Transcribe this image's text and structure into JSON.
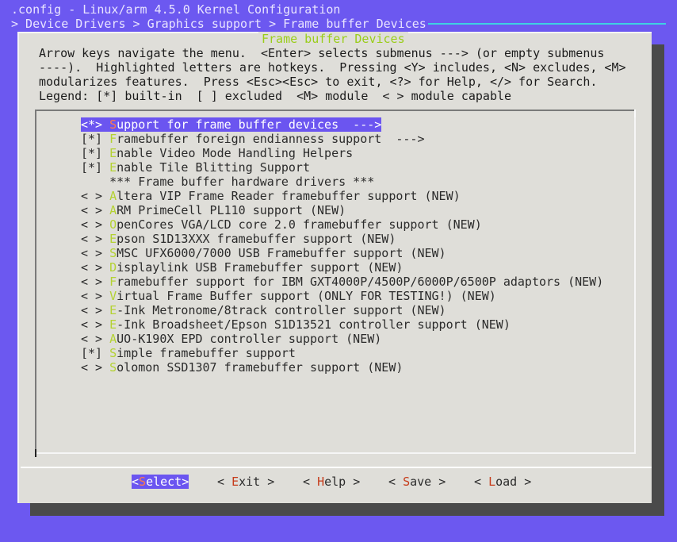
{
  "window": {
    "title": ".config - Linux/arm 4.5.0 Kernel Configuration",
    "breadcrumb": "> Device Drivers > Graphics support > Frame buffer Devices"
  },
  "dialog": {
    "title": "Frame buffer Devices",
    "help_lines": [
      "Arrow keys navigate the menu.  <Enter> selects submenus ---> (or empty submenus",
      "----).  Highlighted letters are hotkeys.  Pressing <Y> includes, <N> excludes, <M>",
      "modularizes features.  Press <Esc><Esc> to exit, <?> for Help, </> for Search.",
      "Legend: [*] built-in  [ ] excluded  <M> module  < > module capable"
    ]
  },
  "menu": {
    "items": [
      {
        "state": "<*>",
        "hot": "S",
        "rest": "upport for frame buffer devices  --->",
        "selected": true
      },
      {
        "state": "[*]",
        "hot": "F",
        "rest": "ramebuffer foreign endianness support  --->"
      },
      {
        "state": "[*]",
        "hot": "E",
        "rest": "nable Video Mode Handling Helpers"
      },
      {
        "state": "[*]",
        "hot": "E",
        "rest": "nable Tile Blitting Support"
      },
      {
        "state": "   ",
        "hot": "",
        "rest": "*** Frame buffer hardware drivers ***"
      },
      {
        "state": "< >",
        "hot": "A",
        "rest": "ltera VIP Frame Reader framebuffer support (NEW)"
      },
      {
        "state": "< >",
        "hot": "A",
        "rest": "RM PrimeCell PL110 support (NEW)"
      },
      {
        "state": "< >",
        "hot": "O",
        "rest": "penCores VGA/LCD core 2.0 framebuffer support (NEW)"
      },
      {
        "state": "< >",
        "hot": "E",
        "rest": "pson S1D13XXX framebuffer support (NEW)"
      },
      {
        "state": "< >",
        "hot": "S",
        "rest": "MSC UFX6000/7000 USB Framebuffer support (NEW)"
      },
      {
        "state": "< >",
        "hot": "D",
        "rest": "isplaylink USB Framebuffer support (NEW)"
      },
      {
        "state": "< >",
        "hot": "F",
        "rest": "ramebuffer support for IBM GXT4000P/4500P/6000P/6500P adaptors (NEW)"
      },
      {
        "state": "< >",
        "hot": "V",
        "rest": "irtual Frame Buffer support (ONLY FOR TESTING!) (NEW)"
      },
      {
        "state": "< >",
        "hot": "E",
        "rest": "-Ink Metronome/8track controller support (NEW)"
      },
      {
        "state": "< >",
        "hot": "E",
        "rest": "-Ink Broadsheet/Epson S1D13521 controller support (NEW)"
      },
      {
        "state": "< >",
        "hot": "A",
        "rest": "UO-K190X EPD controller support (NEW)"
      },
      {
        "state": "[*]",
        "hot": "S",
        "rest": "imple framebuffer support"
      },
      {
        "state": "< >",
        "hot": "S",
        "rest": "olomon SSD1307 framebuffer support (NEW)"
      }
    ]
  },
  "buttons": [
    {
      "pre": "<",
      "hot": "S",
      "rest": "elect>",
      "active": true
    },
    {
      "pre": "< ",
      "hot": "E",
      "rest": "xit >"
    },
    {
      "pre": "< ",
      "hot": "H",
      "rest": "elp >"
    },
    {
      "pre": "< ",
      "hot": "S",
      "rest": "ave >"
    },
    {
      "pre": "< ",
      "hot": "L",
      "rest": "oad >"
    }
  ],
  "background_fragment": "dd",
  "colors": {
    "background": "#6c58f0",
    "dialog": "#dfded9",
    "hotkey": "#b4d232",
    "selection": "#6b55f0",
    "button_hotkey": "#c63b1a"
  }
}
